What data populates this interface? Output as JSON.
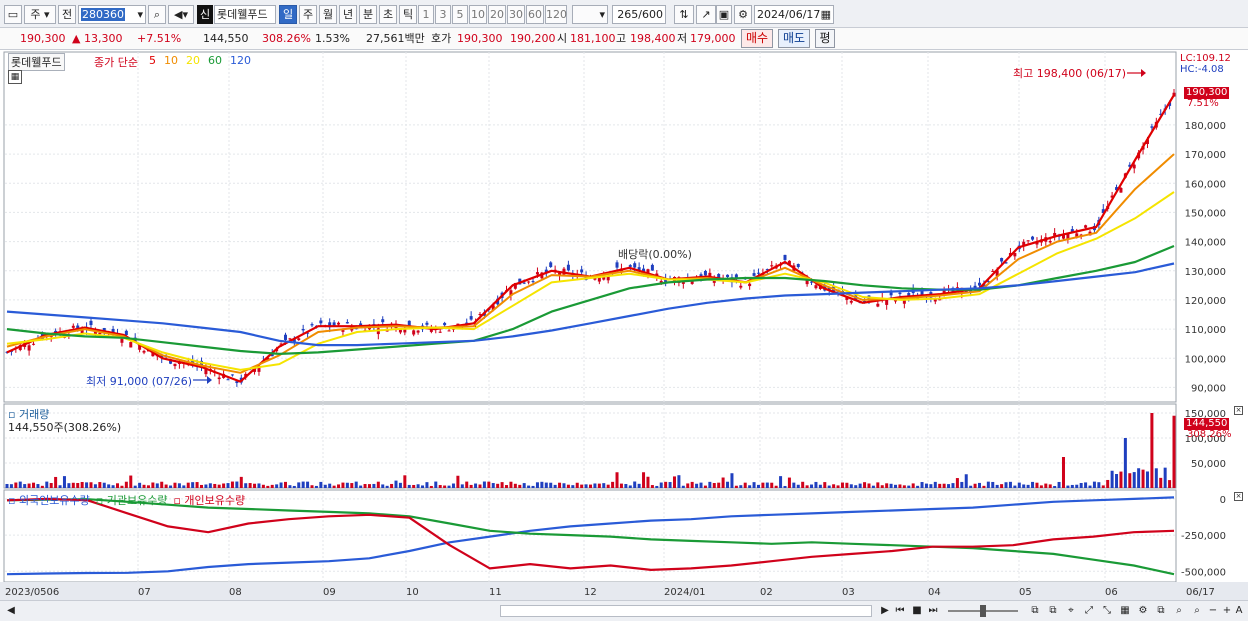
{
  "toolbar": {
    "market": "주",
    "prev": "전",
    "code": "280360",
    "stock_name": "롯데웰푸드",
    "badge": "신",
    "periods": [
      "일",
      "주",
      "월",
      "년",
      "분",
      "초",
      "틱"
    ],
    "intervals": [
      "1",
      "3",
      "5",
      "10",
      "20",
      "30",
      "60",
      "120"
    ],
    "count_value": "265",
    "count_max": "/600",
    "date": "2024/06/17"
  },
  "info": {
    "price": "190,300",
    "change": "▲  13,300",
    "change_pct": "+7.51%",
    "volume": "144,550",
    "volume_pct": "308.26%",
    "turnover": "1.53%",
    "amount": "27,561백만",
    "quote_label": "호가",
    "ask": "190,300",
    "bid": "190,200",
    "open_label": "시",
    "open": "181,100",
    "high_label": "고",
    "high": "198,400",
    "low_label": "저",
    "low": "179,000",
    "buy": "매수",
    "sell": "매도",
    "avg": "평"
  },
  "price_pane": {
    "name_box": "롯데웰푸드",
    "legend_prefix": "종가 단순",
    "ma_periods": [
      "5",
      "10",
      "20",
      "60",
      "120"
    ],
    "ma_colors": [
      "#e00000",
      "#f08c00",
      "#f5e400",
      "#1a9a36",
      "#2a5bd7"
    ],
    "lc": "LC:109.12",
    "hc": "HC:-4.08",
    "max_note": "최고 198,400 (06/17)",
    "min_note": "최저 91,000 (07/26)",
    "dividend_note": "배당락(0.00%)",
    "cur_price": "190,300",
    "cur_pct": "7.51%",
    "y_ticks": [
      "180,000",
      "170,000",
      "160,000",
      "150,000",
      "140,000",
      "130,000",
      "120,000",
      "110,000",
      "100,000",
      "90,000"
    ]
  },
  "volume_pane": {
    "title": "거래량",
    "value_text": "144,550주(308.26%)",
    "cur_value": "144,550",
    "cur_pct": "308.26%",
    "y_ticks": [
      "150,000",
      "100,000",
      "50,000"
    ]
  },
  "holdings_pane": {
    "legend": [
      "외국인보유수량",
      "기관보유수량",
      "개인보유수량"
    ],
    "colors": [
      "#2a5bd7",
      "#1a9a36",
      "#d0021b"
    ],
    "y_ticks": [
      "0",
      "-250,000",
      "-500,000"
    ]
  },
  "x_axis": [
    "2023/0506",
    "07",
    "08",
    "09",
    "10",
    "11",
    "12",
    "2024/01",
    "02",
    "03",
    "04",
    "05",
    "06",
    "06/17"
  ],
  "chart_data": {
    "type": "line",
    "ylim": [
      85000,
      205000
    ],
    "series": [
      {
        "name": "5",
        "values": [
          102000,
          108000,
          110500,
          108000,
          100000,
          97000,
          92000,
          104000,
          111000,
          111000,
          111500,
          110000,
          112000,
          125000,
          130000,
          128000,
          131000,
          127000,
          128000,
          126000,
          133000,
          124000,
          119000,
          121000,
          122000,
          124000,
          138000,
          142000,
          145000,
          168000,
          190300
        ]
      },
      {
        "name": "10",
        "values": [
          104000,
          107500,
          110000,
          107500,
          101000,
          97500,
          95000,
          101000,
          109000,
          110500,
          111000,
          110500,
          111000,
          122000,
          128500,
          128000,
          130000,
          127000,
          127500,
          126000,
          131000,
          125000,
          120000,
          120500,
          121500,
          123000,
          134000,
          140000,
          143000,
          158000,
          170000
        ]
      },
      {
        "name": "20",
        "values": [
          105000,
          106500,
          108500,
          107000,
          102000,
          98500,
          96000,
          98000,
          105000,
          109000,
          110000,
          110500,
          110000,
          118000,
          126000,
          127500,
          129000,
          127000,
          127000,
          126000,
          129000,
          126000,
          121000,
          120000,
          120500,
          122000,
          129000,
          136000,
          141000,
          148000,
          157000
        ]
      },
      {
        "name": "60",
        "values": [
          110000,
          108500,
          107500,
          107000,
          105500,
          104000,
          102500,
          101500,
          102000,
          103000,
          104000,
          105000,
          106000,
          110000,
          116000,
          120000,
          124000,
          126000,
          127000,
          127500,
          127500,
          126500,
          125000,
          124000,
          123500,
          123500,
          125000,
          127500,
          130000,
          133000,
          138500
        ]
      },
      {
        "name": "120",
        "values": [
          116000,
          115000,
          114000,
          113000,
          112000,
          110500,
          109000,
          106000,
          104500,
          104500,
          105000,
          105500,
          106000,
          107500,
          109500,
          112000,
          114500,
          117000,
          119000,
          120500,
          121500,
          122000,
          122500,
          123000,
          123500,
          124000,
          125000,
          126500,
          128000,
          129500,
          132500
        ]
      }
    ]
  }
}
